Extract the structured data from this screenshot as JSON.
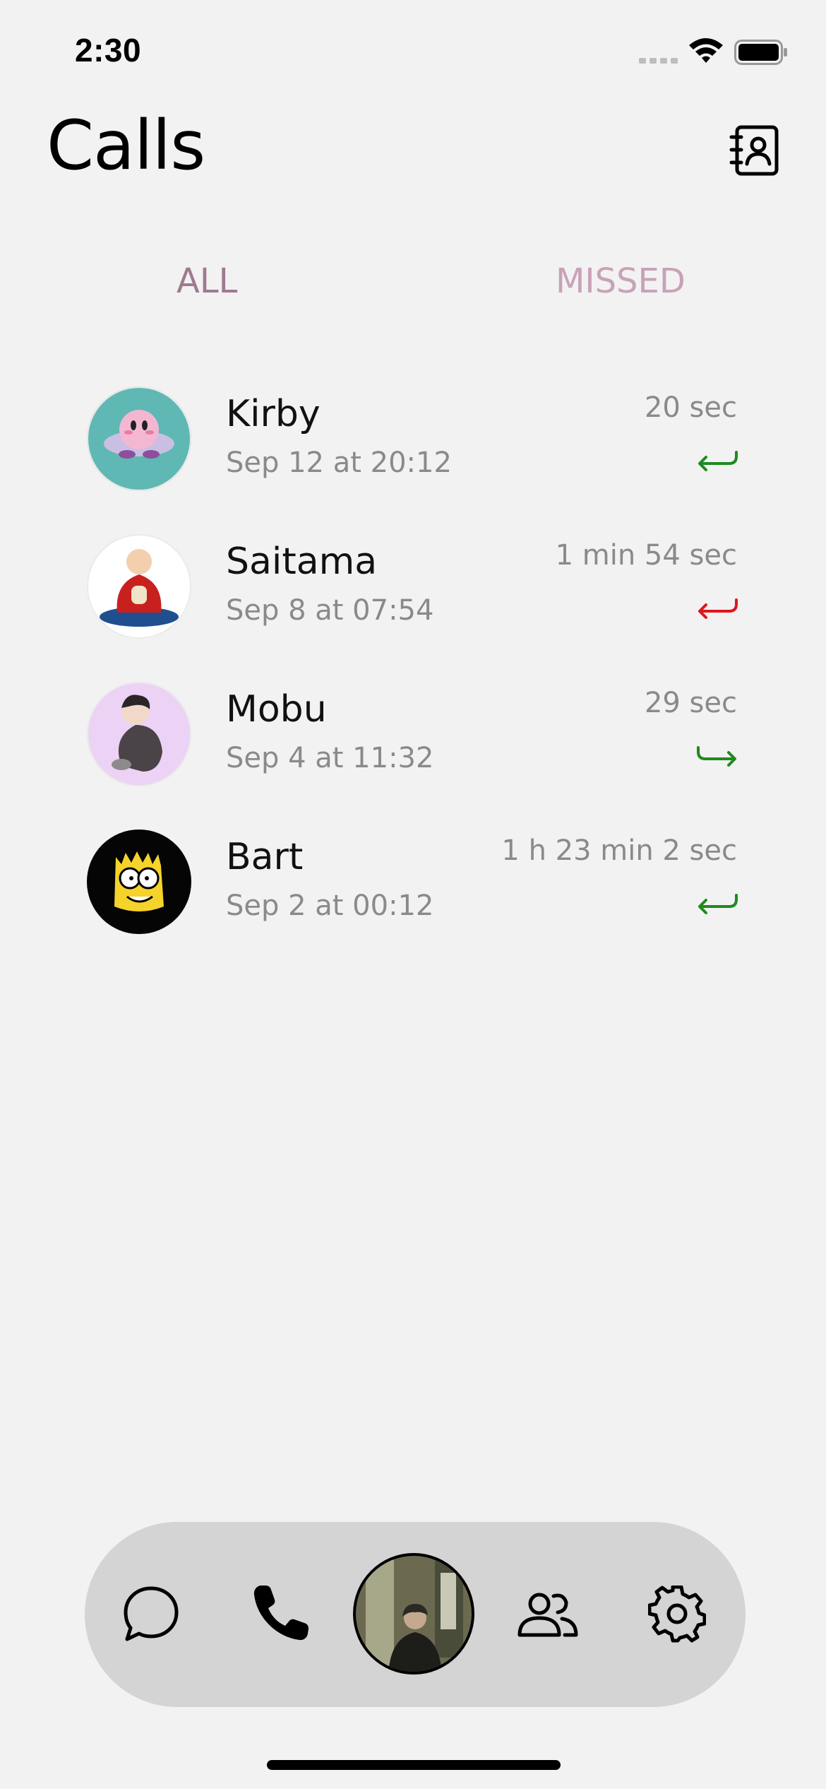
{
  "status_bar": {
    "time": "2:30"
  },
  "header": {
    "title": "Calls",
    "contacts_icon": "contacts-book-icon"
  },
  "tabs": [
    {
      "label": "ALL",
      "selected": true,
      "color": "#a07a90"
    },
    {
      "label": "MISSED",
      "selected": false,
      "color": "#c9a2b7"
    }
  ],
  "calls": [
    {
      "name": "Kirby",
      "time": "Sep 12 at 20:12",
      "duration": "20 sec",
      "direction": "incoming",
      "status_color": "#1f8a1f"
    },
    {
      "name": "Saitama",
      "time": "Sep 8 at 07:54",
      "duration": "1 min 54 sec",
      "direction": "incoming",
      "status_color": "#e0161b"
    },
    {
      "name": "Mobu",
      "time": "Sep 4 at 11:32",
      "duration": "29 sec",
      "direction": "outgoing",
      "status_color": "#1f8a1f"
    },
    {
      "name": "Bart",
      "time": "Sep 2 at 00:12",
      "duration": "1 h 23 min 2 sec",
      "direction": "incoming",
      "status_color": "#1f8a1f"
    }
  ],
  "tab_bar": {
    "items": [
      "chat-icon",
      "phone-icon",
      "profile-avatar",
      "people-icon",
      "settings-icon"
    ]
  }
}
